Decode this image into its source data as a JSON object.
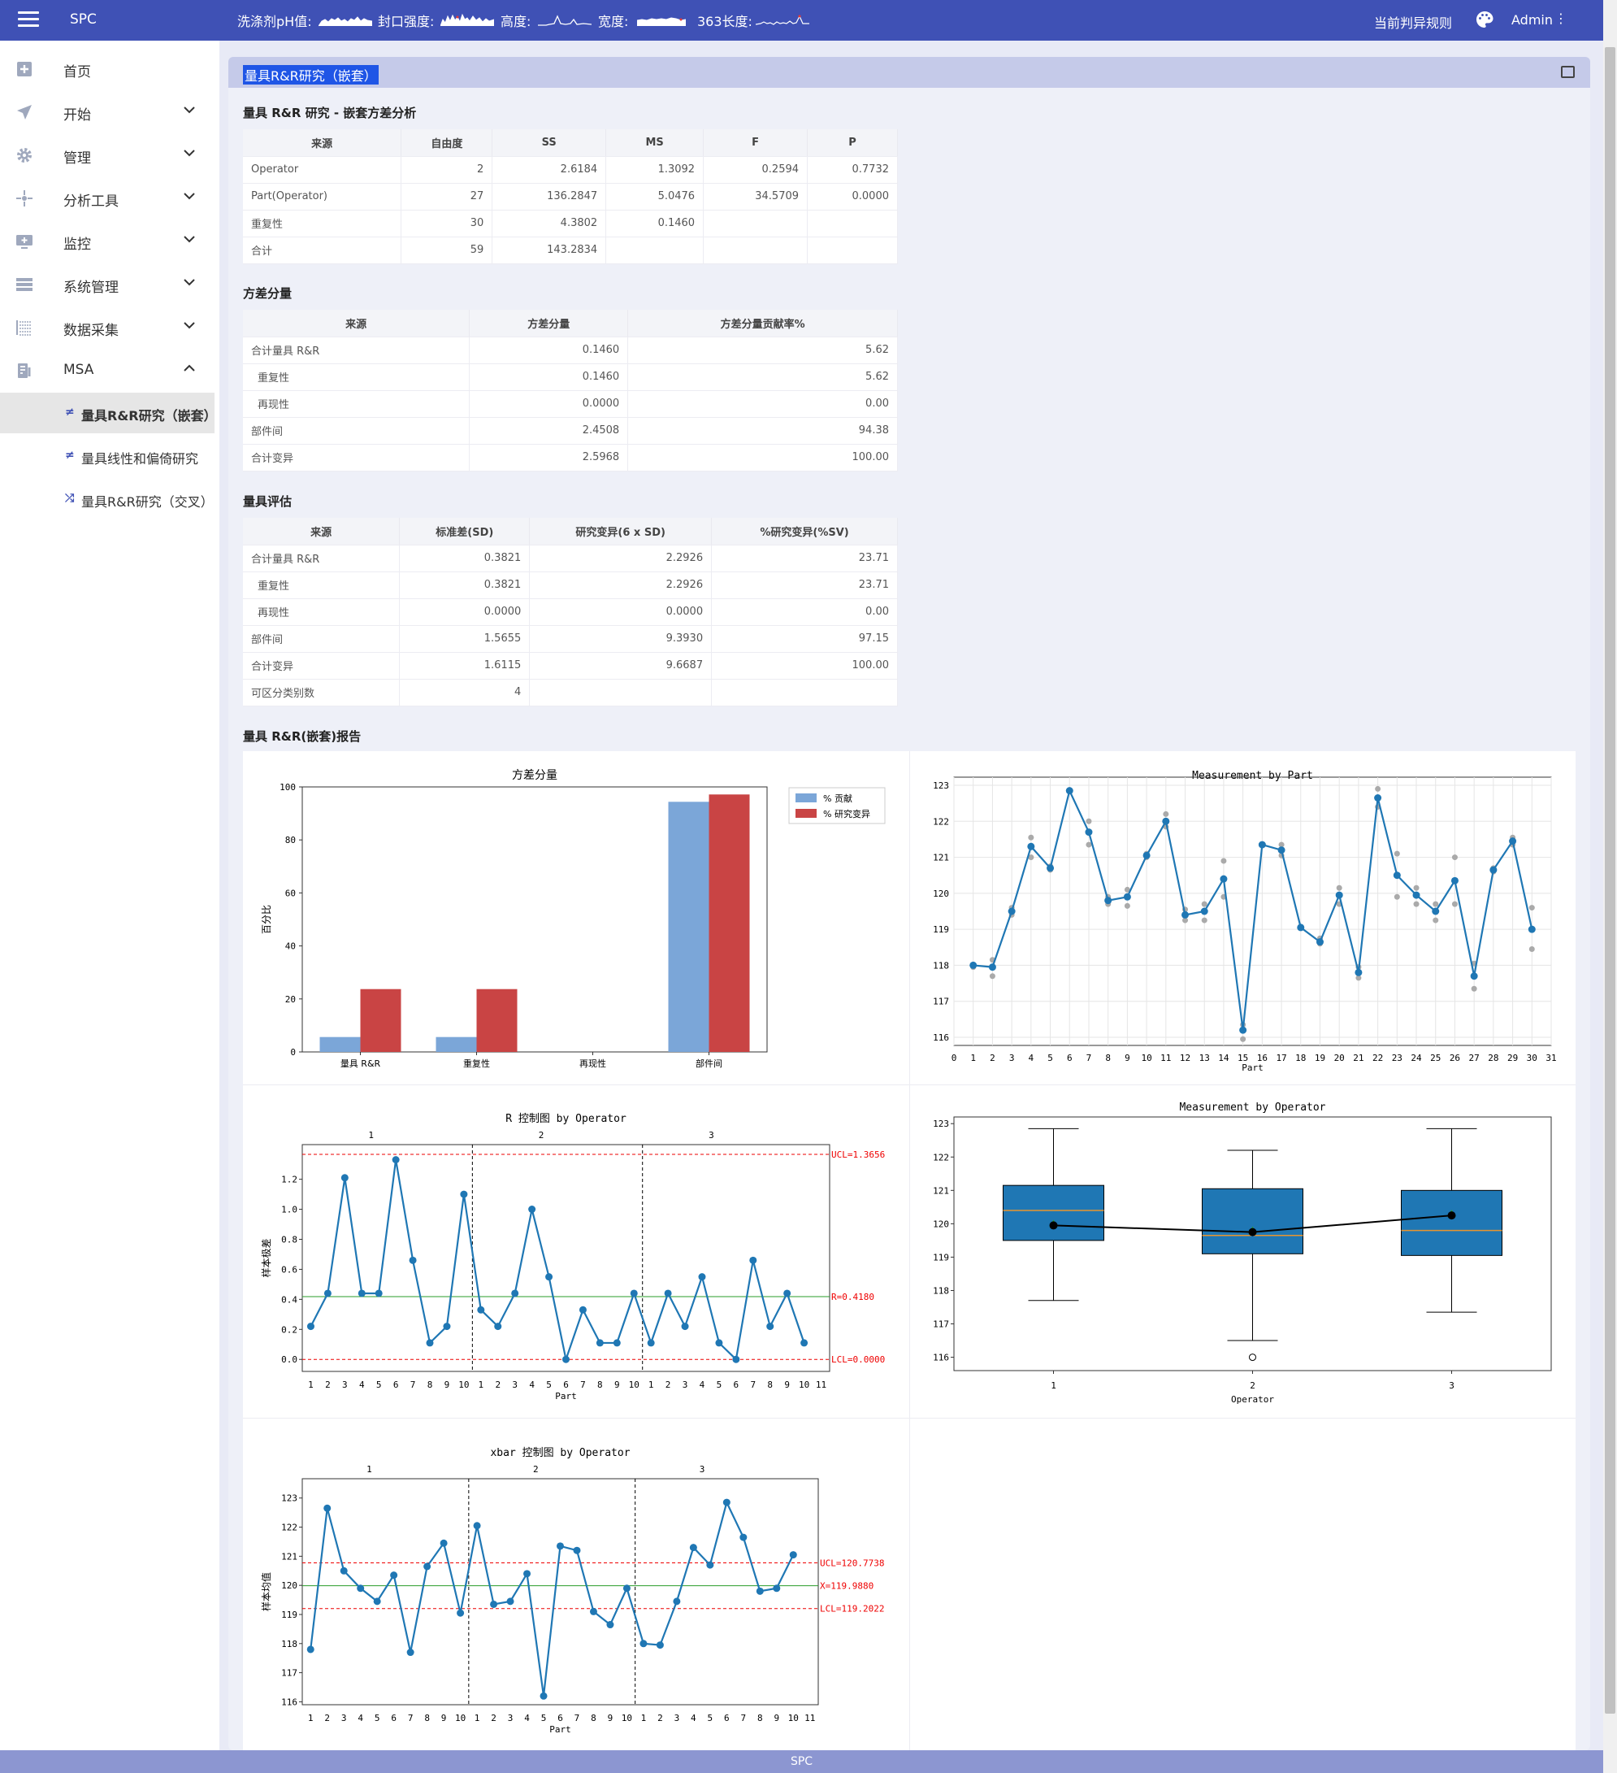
{
  "topbar": {
    "brand": "SPC",
    "sparklines": [
      {
        "label": "洗涤剂pH值:",
        "color": "#ffffff"
      },
      {
        "label": "封口强度:",
        "color": "#ffffff"
      },
      {
        "label": "高度:",
        "color": "#ffffff"
      },
      {
        "label": "宽度:",
        "color": "#ffffff"
      },
      {
        "label": "363长度:",
        "color": "#ffffff"
      }
    ],
    "rule_link": "当前判异规则",
    "user": "Admin",
    "more": "⋮"
  },
  "sidebar": {
    "items": [
      {
        "label": "首页",
        "icon": "home-icon",
        "chevron": "none"
      },
      {
        "label": "开始",
        "icon": "send-icon",
        "chevron": "down"
      },
      {
        "label": "管理",
        "icon": "gear-icon",
        "chevron": "down"
      },
      {
        "label": "分析工具",
        "icon": "crosshair-icon",
        "chevron": "down"
      },
      {
        "label": "监控",
        "icon": "monitor-icon",
        "chevron": "down"
      },
      {
        "label": "系统管理",
        "icon": "server-icon",
        "chevron": "down"
      },
      {
        "label": "数据采集",
        "icon": "list-icon",
        "chevron": "down"
      },
      {
        "label": "MSA",
        "icon": "gauge-icon",
        "chevron": "up"
      }
    ],
    "sub_items": [
      {
        "label": "量具R&R研究（嵌套）",
        "icon": "≠",
        "active": true
      },
      {
        "label": "量具线性和偏倚研究",
        "icon": "≠",
        "active": false
      },
      {
        "label": "量具R&R研究（交叉）",
        "icon": "⤮",
        "active": false
      }
    ]
  },
  "card": {
    "title": "量具R&R研究（嵌套）"
  },
  "anova": {
    "title": "量具 R&R 研究 - 嵌套方差分析",
    "headers": [
      "来源",
      "自由度",
      "SS",
      "MS",
      "F",
      "P"
    ],
    "rows": [
      [
        "Operator",
        "2",
        "2.6184",
        "1.3092",
        "0.2594",
        "0.7732"
      ],
      [
        "Part(Operator)",
        "27",
        "136.2847",
        "5.0476",
        "34.5709",
        "0.0000"
      ],
      [
        "重复性",
        "30",
        "4.3802",
        "0.1460",
        "",
        ""
      ],
      [
        "合计",
        "59",
        "143.2834",
        "",
        "",
        ""
      ]
    ]
  },
  "varcomp": {
    "title": "方差分量",
    "headers": [
      "来源",
      "方差分量",
      "方差分量贡献率%"
    ],
    "rows": [
      [
        "合计量具 R&R",
        "0.1460",
        "5.62"
      ],
      [
        "重复性",
        "0.1460",
        "5.62"
      ],
      [
        "再现性",
        "0.0000",
        "0.00"
      ],
      [
        "部件间",
        "2.4508",
        "94.38"
      ],
      [
        "合计变异",
        "2.5968",
        "100.00"
      ]
    ]
  },
  "gauge_eval": {
    "title": "量具评估",
    "headers": [
      "来源",
      "标准差(SD)",
      "研究变异(6 x SD)",
      "%研究变异(%SV)"
    ],
    "rows": [
      [
        "合计量具 R&R",
        "0.3821",
        "2.2926",
        "23.71"
      ],
      [
        "重复性",
        "0.3821",
        "2.2926",
        "23.71"
      ],
      [
        "再现性",
        "0.0000",
        "0.0000",
        "0.00"
      ],
      [
        "部件间",
        "1.5655",
        "9.3930",
        "97.15"
      ],
      [
        "合计变异",
        "1.6115",
        "9.6687",
        "100.00"
      ],
      [
        "可区分类别数",
        "4",
        "",
        ""
      ]
    ]
  },
  "report_title": "量具 R&R(嵌套)报告",
  "footer": "SPC",
  "chart_data": [
    {
      "type": "bar",
      "title": "方差分量",
      "ylabel": "百分比",
      "categories": [
        "量具 R&R",
        "重复性",
        "再现性",
        "部件间"
      ],
      "series": [
        {
          "name": "% 贡献",
          "values": [
            5.62,
            5.62,
            0.0,
            94.38
          ],
          "color": "#7ba6d8"
        },
        {
          "name": "% 研究变异",
          "values": [
            23.71,
            23.71,
            0.0,
            97.15
          ],
          "color": "#c94444"
        }
      ],
      "ylim": [
        0,
        100
      ],
      "yticks": [
        0,
        20,
        40,
        60,
        80,
        100
      ],
      "legend": "top-right"
    },
    {
      "type": "scatter",
      "title": "Measurement by Part",
      "xlabel": "Part",
      "xlim": [
        0,
        31
      ],
      "ylim": [
        116,
        123
      ],
      "xticks": [
        0,
        1,
        2,
        3,
        4,
        5,
        6,
        7,
        8,
        9,
        10,
        11,
        12,
        13,
        14,
        15,
        16,
        17,
        18,
        19,
        20,
        21,
        22,
        23,
        24,
        25,
        26,
        27,
        28,
        29,
        30,
        31
      ],
      "yticks": [
        116,
        117,
        118,
        119,
        120,
        121,
        122,
        123
      ],
      "grid": true,
      "means": [
        118.0,
        117.95,
        119.5,
        121.3,
        120.7,
        122.85,
        121.7,
        119.8,
        119.9,
        121.05,
        122.0,
        119.4,
        119.5,
        120.4,
        116.2,
        121.35,
        121.2,
        119.05,
        118.65,
        119.95,
        117.8,
        122.65,
        120.5,
        119.95,
        119.5,
        120.35,
        117.7,
        120.65,
        121.45,
        119.0
      ],
      "individuals": [
        [
          117.95,
          118.0
        ],
        [
          118.15,
          117.7
        ],
        [
          119.6,
          119.4
        ],
        [
          121.55,
          121.0
        ],
        [
          120.75,
          120.65
        ],
        [
          122.85,
          122.85
        ],
        [
          122.0,
          121.35
        ],
        [
          119.7,
          119.9
        ],
        [
          120.1,
          119.65
        ],
        [
          121.1,
          121.0
        ],
        [
          122.2,
          121.85
        ],
        [
          119.55,
          119.25
        ],
        [
          119.7,
          119.25
        ],
        [
          120.9,
          119.9
        ],
        [
          116.35,
          115.95
        ],
        [
          121.35,
          121.35
        ],
        [
          121.35,
          121.05
        ],
        [
          119.05,
          119.05
        ],
        [
          118.75,
          118.6
        ],
        [
          120.15,
          119.7
        ],
        [
          117.95,
          117.65
        ],
        [
          122.9,
          122.4
        ],
        [
          121.1,
          119.9
        ],
        [
          120.15,
          119.7
        ],
        [
          119.7,
          119.25
        ],
        [
          121.0,
          119.7
        ],
        [
          118.05,
          117.35
        ],
        [
          120.7,
          120.6
        ],
        [
          121.55,
          121.35
        ],
        [
          119.6,
          118.45
        ]
      ]
    },
    {
      "type": "line",
      "title": "R 控制图 by Operator",
      "xlabel": "Part",
      "ylabel": "样本极差",
      "groups": [
        "1",
        "2",
        "3"
      ],
      "x_tick_labels": [
        "1",
        "2",
        "3",
        "4",
        "5",
        "6",
        "7",
        "8",
        "9",
        "10",
        "1",
        "2",
        "3",
        "4",
        "5",
        "6",
        "7",
        "8",
        "9",
        "10",
        "1",
        "2",
        "3",
        "4",
        "5",
        "6",
        "7",
        "8",
        "9",
        "10",
        "11"
      ],
      "values": [
        0.22,
        0.44,
        1.21,
        0.44,
        0.44,
        1.33,
        0.66,
        0.11,
        0.22,
        1.1,
        0.33,
        0.22,
        0.44,
        1.0,
        0.55,
        0.0,
        0.33,
        0.11,
        0.11,
        0.44,
        0.11,
        0.44,
        0.22,
        0.55,
        0.11,
        0.0,
        0.66,
        0.22,
        0.44,
        0.11
      ],
      "ucl": 1.3656,
      "center": 0.418,
      "lcl": 0.0,
      "ucl_label": "UCL=1.3656",
      "center_label": "R=0.4180",
      "lcl_label": "LCL=0.0000",
      "ylim": [
        -0.08,
        1.42
      ],
      "yticks": [
        0.0,
        0.2,
        0.4,
        0.6,
        0.8,
        1.0,
        1.2
      ]
    },
    {
      "type": "box",
      "title": "Measurement by Operator",
      "xlabel": "Operator",
      "categories": [
        "1",
        "2",
        "3"
      ],
      "boxes": [
        {
          "min": 117.7,
          "q1": 119.5,
          "median": 120.4,
          "q3": 121.15,
          "max": 122.85,
          "mean": 119.95,
          "outliers": []
        },
        {
          "min": 116.5,
          "q1": 119.1,
          "median": 119.65,
          "q3": 121.05,
          "max": 122.2,
          "mean": 119.75,
          "outliers": [
            116.0
          ]
        },
        {
          "min": 117.35,
          "q1": 119.05,
          "median": 119.8,
          "q3": 121.0,
          "max": 122.85,
          "mean": 120.25,
          "outliers": []
        }
      ],
      "ylim": [
        115.6,
        123.2
      ],
      "yticks": [
        116,
        117,
        118,
        119,
        120,
        121,
        122,
        123
      ]
    },
    {
      "type": "line",
      "title": "xbar 控制图 by Operator",
      "xlabel": "Part",
      "ylabel": "样本均值",
      "groups": [
        "1",
        "2",
        "3"
      ],
      "x_tick_labels": [
        "1",
        "2",
        "3",
        "4",
        "5",
        "6",
        "7",
        "8",
        "9",
        "10",
        "1",
        "2",
        "3",
        "4",
        "5",
        "6",
        "7",
        "8",
        "9",
        "10",
        "1",
        "2",
        "3",
        "4",
        "5",
        "6",
        "7",
        "8",
        "9",
        "10",
        "11"
      ],
      "values": [
        117.8,
        122.65,
        120.5,
        119.9,
        119.45,
        120.35,
        117.7,
        120.65,
        121.45,
        119.05,
        122.05,
        119.35,
        119.45,
        120.4,
        116.2,
        121.35,
        121.2,
        119.1,
        118.65,
        119.9,
        118.0,
        117.95,
        119.45,
        121.3,
        120.7,
        122.85,
        121.65,
        119.8,
        119.9,
        121.05
      ],
      "ucl": 120.7738,
      "center": 119.988,
      "lcl": 119.2022,
      "ucl_label": "UCL=120.7738",
      "center_label": "X=119.9880",
      "lcl_label": "LCL=119.2022",
      "ylim": [
        115.9,
        123.3
      ],
      "yticks": [
        116,
        117,
        118,
        119,
        120,
        121,
        122,
        123
      ]
    }
  ]
}
